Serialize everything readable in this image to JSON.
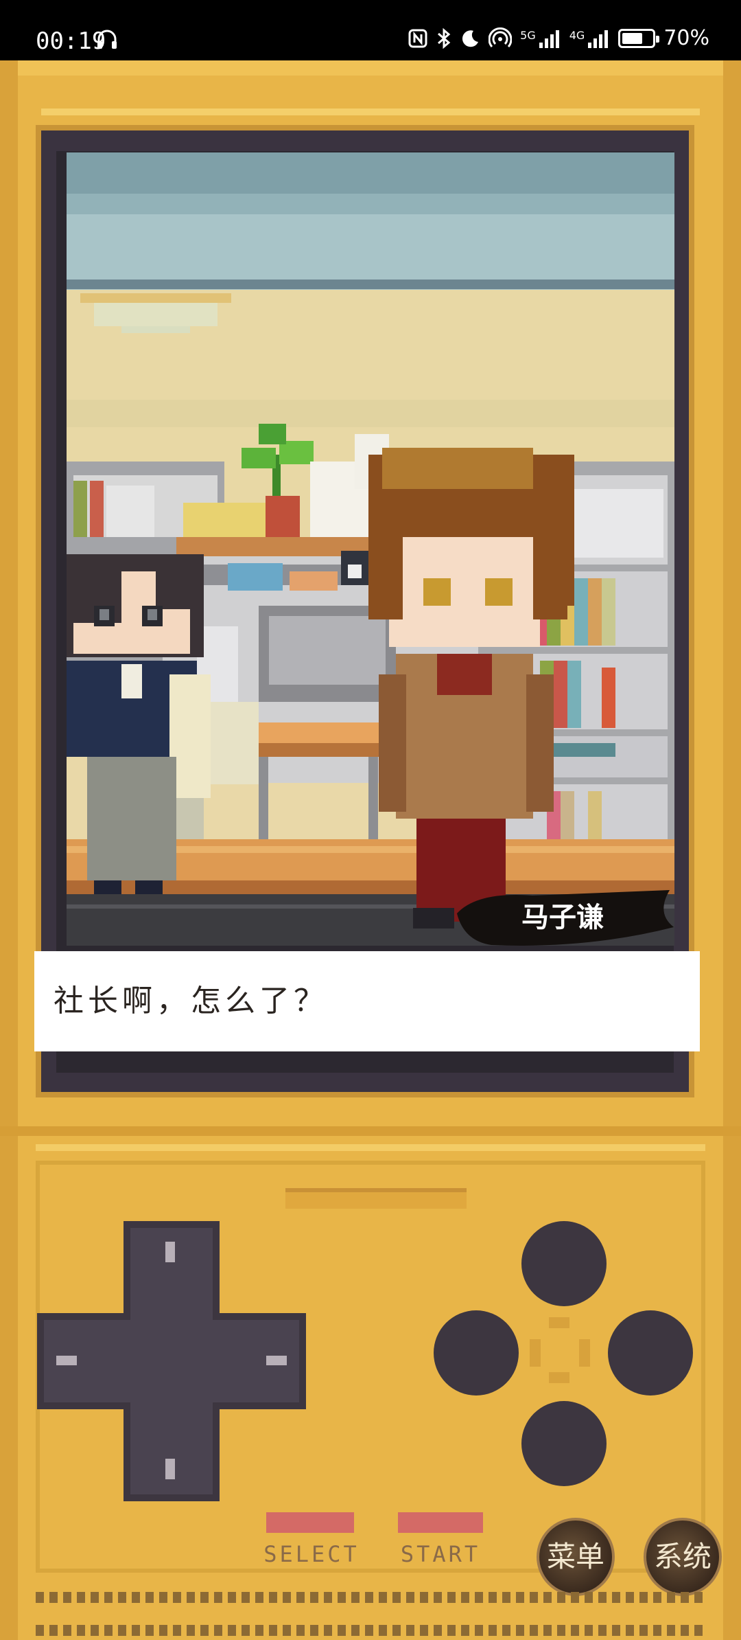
{
  "status_bar": {
    "time": "00:19",
    "battery": "70%",
    "battery_level": 0.7,
    "icons": [
      "headphones-icon",
      "nfc-icon",
      "bluetooth-icon",
      "moon-icon",
      "hotspot-icon",
      "signal-5g-icon",
      "signal-4g-icon",
      "battery-icon"
    ],
    "net1": "5G",
    "net2": "4G"
  },
  "game": {
    "speaker_name": "马子谦",
    "dialog_text": "社长啊，怎么了？"
  },
  "controls": {
    "select_label": "SELECT",
    "start_label": "START",
    "menu_label": "菜单",
    "system_label": "系统"
  },
  "colors": {
    "console": "#e8b548",
    "bezel": "#3a3340",
    "button_dark": "#3c3640",
    "select_start": "#d46a66"
  }
}
